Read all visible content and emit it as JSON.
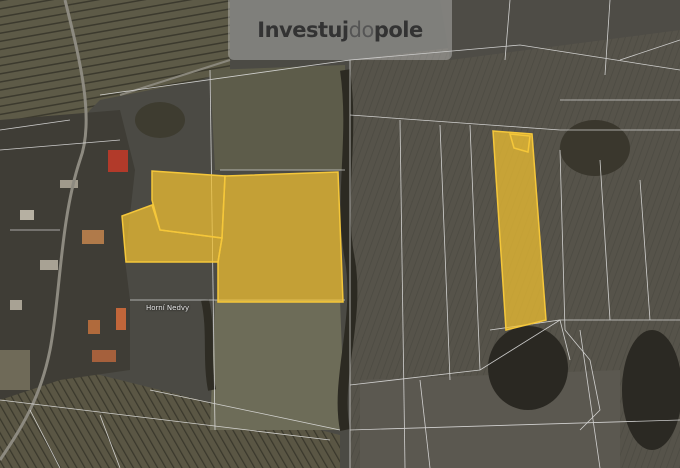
{
  "watermark": {
    "part1": "Investuj",
    "part2": "do",
    "part3": "pole"
  },
  "map": {
    "place_label": "Horní Nedvy",
    "highlight_color": "#f2c230",
    "parcel_line_color": "#e6e6e6"
  }
}
